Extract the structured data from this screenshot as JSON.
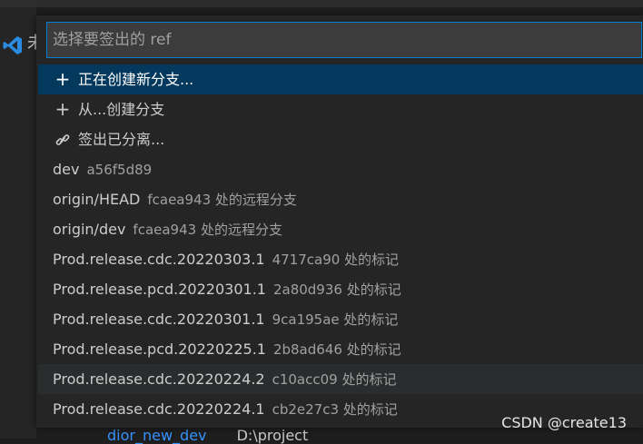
{
  "background": {
    "overlapped_char": "未",
    "bottom_link": "dior_new_dev",
    "bottom_path": "D:\\project"
  },
  "quick_pick": {
    "placeholder": "选择要签出的 ref",
    "actions": [
      {
        "icon": "+",
        "label": "正在创建新分支..."
      },
      {
        "icon": "+",
        "label": "从...创建分支"
      },
      {
        "icon": "link",
        "label": "签出已分离..."
      }
    ],
    "refs": [
      {
        "name": "dev",
        "detail": "a56f5d89"
      },
      {
        "name": "origin/HEAD",
        "detail": "fcaea943 处的远程分支"
      },
      {
        "name": "origin/dev",
        "detail": "fcaea943 处的远程分支"
      },
      {
        "name": "Prod.release.cdc.20220303.1",
        "detail": "4717ca90 处的标记"
      },
      {
        "name": "Prod.release.pcd.20220301.1",
        "detail": "2a80d936 处的标记"
      },
      {
        "name": "Prod.release.cdc.20220301.1",
        "detail": "9ca195ae 处的标记"
      },
      {
        "name": "Prod.release.pcd.20220225.1",
        "detail": "2b8ad646 处的标记"
      },
      {
        "name": "Prod.release.cdc.20220224.2",
        "detail": "c10acc09 处的标记"
      },
      {
        "name": "Prod.release.cdc.20220224.1",
        "detail": "cb2e27c3 处的标记"
      }
    ]
  },
  "watermark": "CSDN @create13",
  "colors": {
    "selection": "#04395e",
    "focus_border": "#007fd4",
    "link": "#3794ff"
  }
}
